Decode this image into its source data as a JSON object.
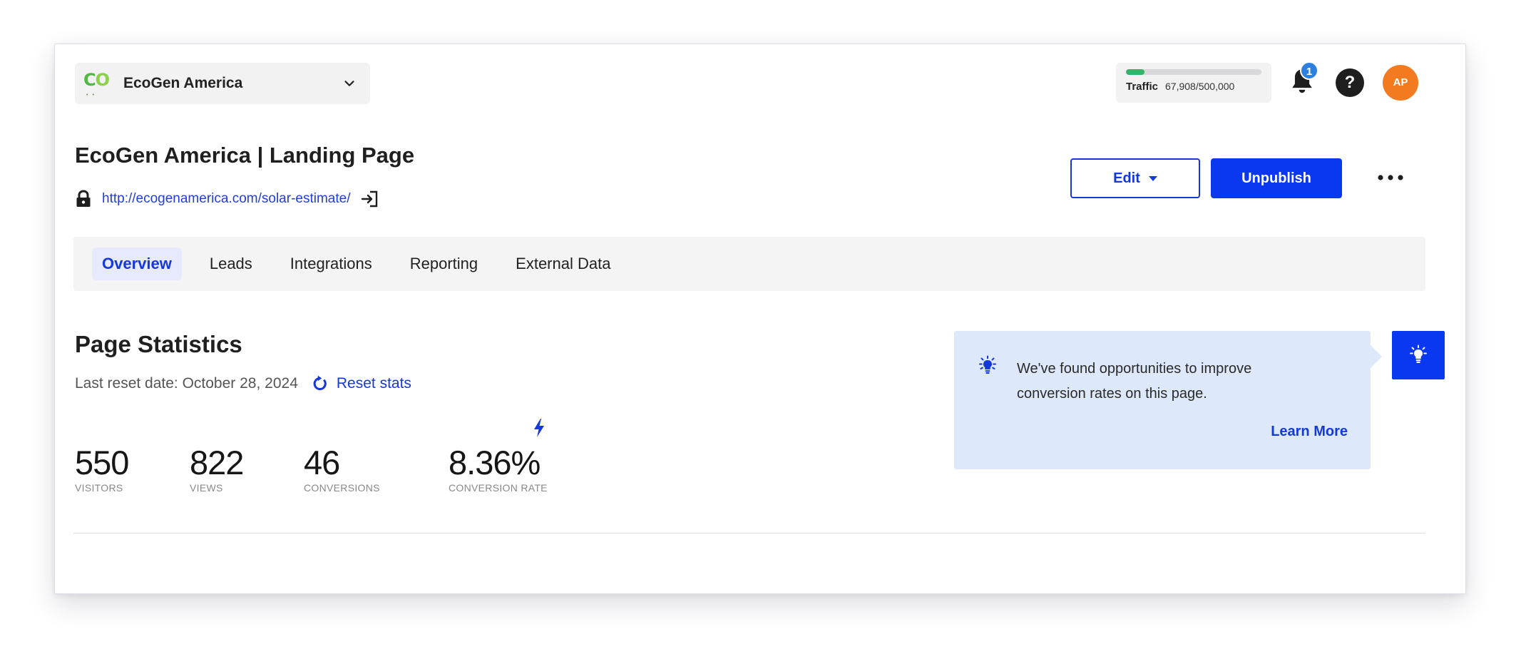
{
  "account": {
    "logo_text_1": "C",
    "logo_text_2": "O",
    "name": "EcoGen America"
  },
  "traffic": {
    "label": "Traffic",
    "used": "67,908",
    "limit": "500,000",
    "display": "67,908/500,000",
    "fraction_used": 0.136,
    "bar_color": "#35b36a"
  },
  "notifications": {
    "count": "1",
    "badge_color": "#2d7fe0"
  },
  "help": {
    "glyph": "?"
  },
  "user": {
    "initials": "AP",
    "avatar_color": "#f47a20"
  },
  "page": {
    "title": "EcoGen America | Landing Page",
    "url": "http://ecogenamerica.com/solar-estimate/"
  },
  "actions": {
    "edit_label": "Edit",
    "unpublish_label": "Unpublish",
    "accent": "#0a38f0"
  },
  "tabs": [
    {
      "label": "Overview",
      "active": true
    },
    {
      "label": "Leads",
      "active": false
    },
    {
      "label": "Integrations",
      "active": false
    },
    {
      "label": "Reporting",
      "active": false
    },
    {
      "label": "External Data",
      "active": false
    }
  ],
  "stats": {
    "title": "Page Statistics",
    "reset_date": "Last reset date: October 28, 2024",
    "reset_label": "Reset stats",
    "items": [
      {
        "value": "550",
        "label": "VISITORS"
      },
      {
        "value": "822",
        "label": "VIEWS"
      },
      {
        "value": "46",
        "label": "CONVERSIONS"
      },
      {
        "value": "8.36%",
        "label": "CONVERSION RATE"
      }
    ]
  },
  "tip": {
    "message": "We've found opportunities to improve conversion rates on this page.",
    "link_label": "Learn More",
    "background": "#dde9fb"
  }
}
